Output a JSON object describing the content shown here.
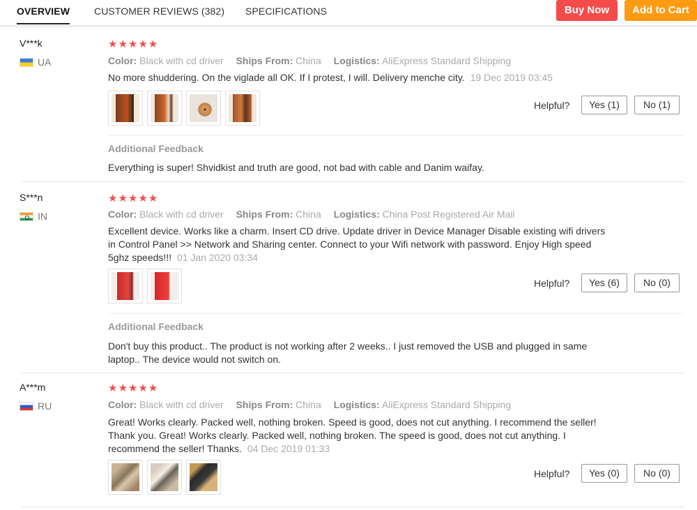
{
  "tabs": {
    "overview": "OVERVIEW",
    "reviews": "CUSTOMER REVIEWS (382)",
    "specs": "SPECIFICATIONS"
  },
  "buttons": {
    "buy_now": "Buy Now",
    "add_to_cart": "Add to Cart"
  },
  "labels": {
    "color": "Color:",
    "ships_from": "Ships From:",
    "logistics": "Logistics:",
    "helpful": "Helpful?",
    "additional_feedback": "Additional Feedback",
    "stars": "★★★★★"
  },
  "reviews": [
    {
      "user": "V***k",
      "country": "UA",
      "rating": 5,
      "color": "Black with cd driver",
      "ships_from": "China",
      "logistics": "AliExpress Standard Shipping",
      "text": "No more shuddering. On the viglade all OK. If I protest, I will. Delivery menche city.",
      "date": "19 Dec 2019 03:45",
      "yes": "Yes (1)",
      "no": "No (1)",
      "feedback": "Everything is super! Shvidkist and truth are good, not bad with cable and Danim waifay."
    },
    {
      "user": "S***n",
      "country": "IN",
      "rating": 5,
      "color": "Black with cd driver",
      "ships_from": "China",
      "logistics": "China Post Registered Air Mail",
      "text": "Excellent device. Works like a charm. Insert CD drive. Update driver in Device Manager Disable existing wifi drivers in Control Panel >> Network and Sharing center. Connect to your Wifi network with password. Enjoy High speed 5ghz speeds!!!",
      "date": "01 Jan 2020 03:34",
      "yes": "Yes (6)",
      "no": "No (0)",
      "feedback": "Don't buy this product.. The product is not working after 2 weeks.. I just removed the USB and plugged in same laptop.. The device would not switch on."
    },
    {
      "user": "A***m",
      "country": "RU",
      "rating": 5,
      "color": "Black with cd driver",
      "ships_from": "China",
      "logistics": "AliExpress Standard Shipping",
      "text": "Great! Works clearly. Packed well, nothing broken. Speed is good, does not cut anything. I recommend the seller! Thank you. Great! Works clearly. Packed well, nothing broken. The speed is good, does not cut anything. I recommend the seller! Thanks.",
      "date": "04 Dec 2019 01:33",
      "yes": "Yes (0)",
      "no": "No (0)"
    }
  ]
}
